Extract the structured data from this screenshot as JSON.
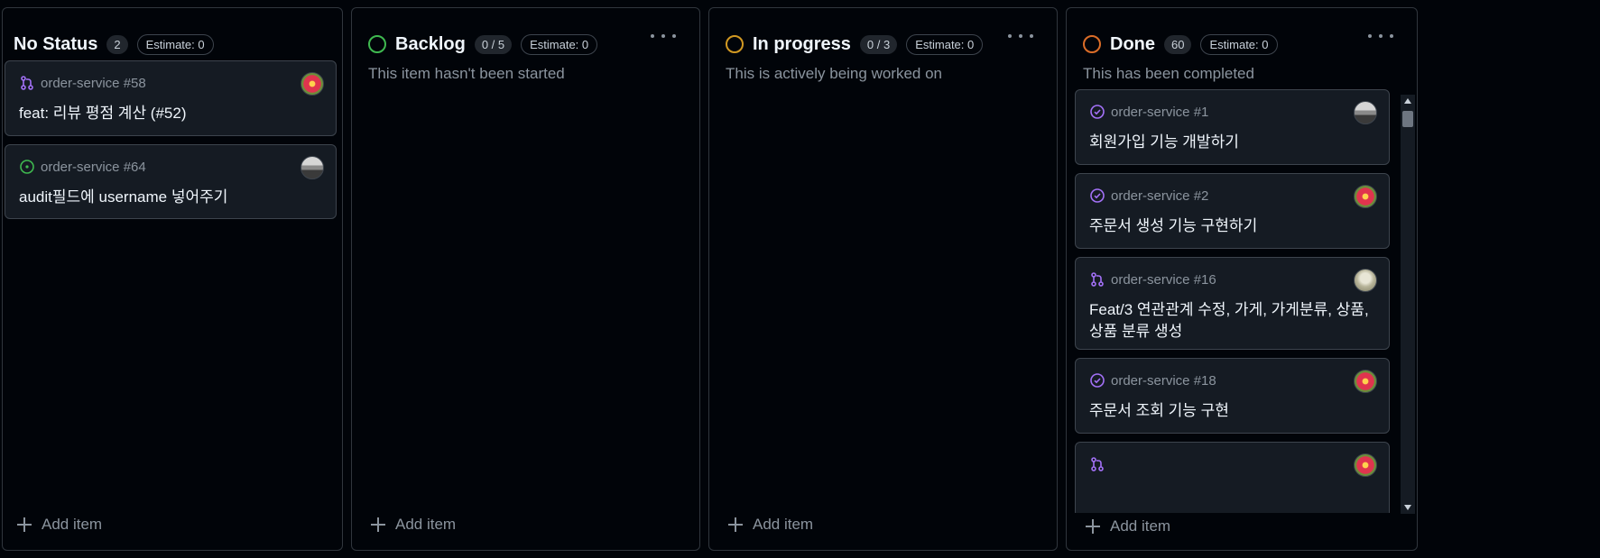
{
  "colors": {
    "backlog": "#3fb950",
    "in_progress": "#d29922",
    "done": "#db6d28",
    "pr_icon": "#a371f7",
    "open_issue": "#3fb950",
    "closed_issue": "#a371f7"
  },
  "columns": [
    {
      "title": "No Status",
      "count": "2",
      "estimate": "Estimate: 0",
      "description": "",
      "add_label": "Add item",
      "cards": [
        {
          "icon": "pull-request-icon",
          "ref": "order-service #58",
          "title": "feat: 리뷰 평점 계산 (#52)"
        },
        {
          "icon": "open-issue-icon",
          "ref": "order-service #64",
          "title": "audit필드에 username 넣어주기"
        }
      ]
    },
    {
      "title": "Backlog",
      "count": "0 / 5",
      "estimate": "Estimate: 0",
      "description": "This item hasn't been started",
      "add_label": "Add item",
      "cards": []
    },
    {
      "title": "In progress",
      "count": "0 / 3",
      "estimate": "Estimate: 0",
      "description": "This is actively being worked on",
      "add_label": "Add item",
      "cards": []
    },
    {
      "title": "Done",
      "count": "60",
      "estimate": "Estimate: 0",
      "description": "This has been completed",
      "add_label": "Add item",
      "cards": [
        {
          "icon": "closed-issue-icon",
          "ref": "order-service #1",
          "title": "회원가입 기능 개발하기"
        },
        {
          "icon": "closed-issue-icon",
          "ref": "order-service #2",
          "title": "주문서 생성 기능 구현하기"
        },
        {
          "icon": "pull-request-icon",
          "ref": "order-service #16",
          "title": "Feat/3 연관관계 수정, 가게, 가게분류, 상품, 상품 분류 생성"
        },
        {
          "icon": "closed-issue-icon",
          "ref": "order-service #18",
          "title": "주문서 조회 기능 구현"
        },
        {
          "icon": "pull-request-icon",
          "ref": "",
          "title": ""
        }
      ]
    }
  ]
}
